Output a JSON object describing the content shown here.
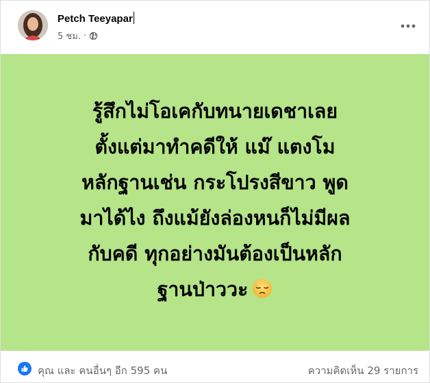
{
  "post": {
    "author_name": "Petch Teeyapar",
    "timestamp": "5 ชม.",
    "separator": "·",
    "privacy_icon": "globe-icon",
    "more_icon": "more-options-icon",
    "background_color": "#b5e489",
    "lines": [
      "รู้สึกไม่โอเคกับทนายเดชาเลย",
      "ตั้งแต่มาทำคดีให้ แม๊ แตงโม",
      "หลักฐานเช่น กระโปรงสีขาว พูด",
      "มาได้ไง ถึงแม้ยังล่องหนก็ไม่มีผล",
      "กับคดี ทุกอย่างมันต้องเป็นหลัก",
      "ฐานป่าววะ"
    ],
    "end_emoji": "pensive-face-emoji"
  },
  "footer": {
    "reaction_icon": "like-icon",
    "reactions_text": "คุณ และ คนอื่นๆ อีก 595 คน",
    "comments_text": "ความคิดเห็น 29 รายการ",
    "accent_color": "#1877f2"
  }
}
